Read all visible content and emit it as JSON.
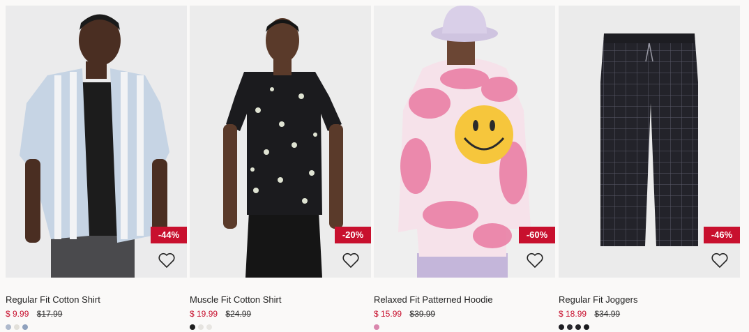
{
  "products": [
    {
      "title": "Regular Fit Cotton Shirt",
      "price": "$ 9.99",
      "original_price": "$17.99",
      "discount": "-44%",
      "photo_bg": "#ebebec",
      "swatches": [
        "#aeb9cc",
        "#e2e0da",
        "#8fa1bd"
      ],
      "favorite_icon": "heart-outline-icon"
    },
    {
      "title": "Muscle Fit Cotton Shirt",
      "price": "$ 19.99",
      "original_price": "$24.99",
      "discount": "-20%",
      "photo_bg": "#ececec",
      "swatches": [
        "#1f1f1f",
        "#e5e3df",
        "#e8e6e2"
      ],
      "favorite_icon": "heart-outline-icon"
    },
    {
      "title": "Relaxed Fit Patterned Hoodie",
      "price": "$ 15.99",
      "original_price": "$39.99",
      "discount": "-60%",
      "photo_bg": "#efefef",
      "swatches": [
        "#d987ad"
      ],
      "favorite_icon": "heart-outline-icon"
    },
    {
      "title": "Regular Fit Joggers",
      "price": "$ 18.99",
      "original_price": "$34.99",
      "discount": "-46%",
      "photo_bg": "#ebebeb",
      "swatches": [
        "#1d1d22",
        "#2b2b31",
        "#222226",
        "#1a1a1e"
      ],
      "favorite_icon": "heart-outline-icon"
    }
  ],
  "colors": {
    "sale_red": "#c8102e",
    "page_bg": "#faf9f8"
  }
}
